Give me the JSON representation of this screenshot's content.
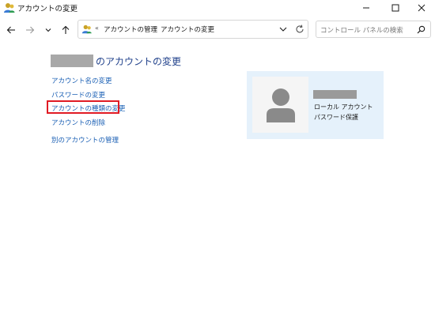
{
  "window": {
    "title": "アカウントの変更",
    "buttons": [
      "minimize",
      "maximize",
      "close"
    ]
  },
  "navigation": {
    "back_icon": "back-arrow-icon",
    "forward_icon": "forward-arrow-icon",
    "recent_icon": "chevron-down-icon",
    "up_icon": "up-arrow-icon"
  },
  "address_bar": {
    "overflow": "«",
    "breadcrumbs": [
      "アカウントの管理",
      "アカウントの変更"
    ],
    "separator": "›"
  },
  "search": {
    "placeholder": "コントロール パネルの検索"
  },
  "main": {
    "heading_suffix": "のアカウントの変更",
    "links": [
      "アカウント名の変更",
      "パスワードの変更",
      "アカウントの種類の変更",
      "アカウントの削除",
      "別のアカウントの管理"
    ],
    "highlighted_link": "アカウントの種類の変更",
    "highlight_color": "#e01b24"
  },
  "account_card": {
    "type": "ローカル アカウント",
    "password": "パスワード保護",
    "background": "#e5f1fb"
  }
}
